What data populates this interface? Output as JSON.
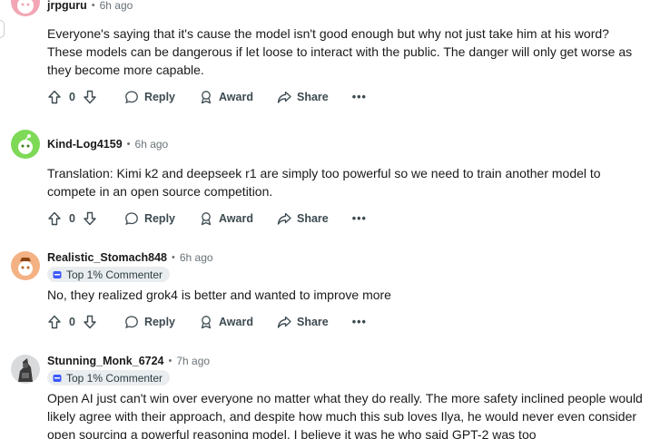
{
  "comments": [
    {
      "author": "jrpguru",
      "time": "6h ago",
      "badge": "",
      "body": "Everyone's saying that it's cause the model isn't good enough but why not just take him at his word? These models can be dangerous if let loose to interact with the public. The danger will only get worse as they become more capable.",
      "votes": "0",
      "avatar_color": "#f2a6b5"
    },
    {
      "author": "Kind-Log4159",
      "time": "6h ago",
      "badge": "",
      "body": "Translation: Kimi k2 and deepseek r1 are simply too powerful so we need to train another model to compete in an open source competition.",
      "votes": "0",
      "avatar_color": "#7ed957"
    },
    {
      "author": "Realistic_Stomach848",
      "time": "6h ago",
      "badge": "Top 1% Commenter",
      "body": "No, they realized grok4 is better and wanted to improve more",
      "votes": "0",
      "avatar_color": "#f4b183"
    },
    {
      "author": "Stunning_Monk_6724",
      "time": "7h ago",
      "badge": "Top 1% Commenter",
      "body": "Open AI just can't win over everyone no matter what they do really. The more safety inclined people would likely agree with their approach, and despite how much this sub loves Ilya, he would never even consider open sourcing a powerful reasoning model. I believe it was he who said GPT-2 was too",
      "votes": "",
      "avatar_color": "#6b6b6b"
    }
  ],
  "actions": {
    "reply": "Reply",
    "award": "Award",
    "share": "Share",
    "more": "•••"
  }
}
